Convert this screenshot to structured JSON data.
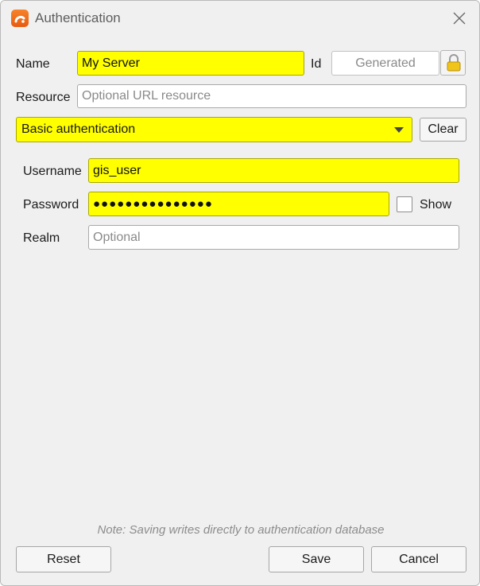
{
  "window": {
    "title": "Authentication",
    "app_icon": "qgis-auth-icon",
    "close_icon": "close-icon"
  },
  "form": {
    "name_label": "Name",
    "name_value": "My Server",
    "id_label": "Id",
    "id_value": "Generated",
    "lock_icon": "lock-icon",
    "resource_label": "Resource",
    "resource_placeholder": "Optional URL resource",
    "method_selected": "Basic authentication",
    "clear_label": "Clear"
  },
  "basic": {
    "username_label": "Username",
    "username_value": "gis_user",
    "password_label": "Password",
    "password_value": "●●●●●●●●●●●●●●●",
    "show_label": "Show",
    "show_checked": false,
    "realm_label": "Realm",
    "realm_placeholder": "Optional"
  },
  "footer": {
    "note": "Note: Saving writes directly to authentication database",
    "reset_label": "Reset",
    "save_label": "Save",
    "cancel_label": "Cancel"
  },
  "colors": {
    "highlight": "#ffff00",
    "brand": "#f07020"
  }
}
